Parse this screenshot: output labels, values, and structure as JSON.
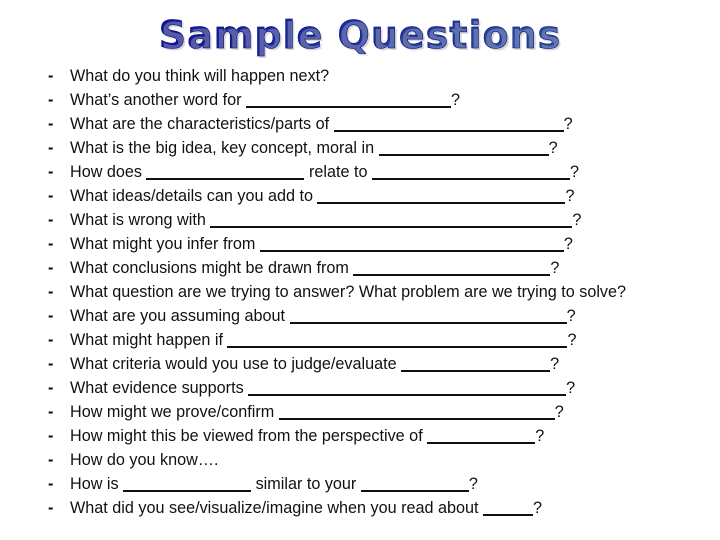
{
  "title": "Sample Questions",
  "bullet": "-",
  "questions": [
    {
      "parts": [
        "What do you think will happen next?"
      ],
      "blanks": []
    },
    {
      "parts": [
        "What’s another word for ",
        "?"
      ],
      "blanks": [
        205
      ]
    },
    {
      "parts": [
        "What are the characteristics/parts of ",
        "?"
      ],
      "blanks": [
        230
      ]
    },
    {
      "parts": [
        "What is the big idea, key concept, moral in ",
        "?"
      ],
      "blanks": [
        170
      ]
    },
    {
      "parts": [
        "How does ",
        " relate to ",
        "?"
      ],
      "blanks": [
        158,
        198
      ]
    },
    {
      "parts": [
        "What ideas/details can you add to ",
        "?"
      ],
      "blanks": [
        248
      ]
    },
    {
      "parts": [
        "What is wrong with ",
        "?"
      ],
      "blanks": [
        362
      ]
    },
    {
      "parts": [
        "What might you infer from ",
        "?"
      ],
      "blanks": [
        304
      ]
    },
    {
      "parts": [
        "What conclusions might be drawn from ",
        "?"
      ],
      "blanks": [
        197
      ]
    },
    {
      "parts": [
        "What question are we trying to answer? What problem are we trying to solve?"
      ],
      "blanks": []
    },
    {
      "parts": [
        "What are you assuming about ",
        "?"
      ],
      "blanks": [
        277
      ]
    },
    {
      "parts": [
        "What might happen if ",
        "?"
      ],
      "blanks": [
        340
      ]
    },
    {
      "parts": [
        "What criteria would you use to judge/evaluate ",
        "?"
      ],
      "blanks": [
        149
      ]
    },
    {
      "parts": [
        "What evidence supports ",
        "?"
      ],
      "blanks": [
        318
      ]
    },
    {
      "parts": [
        "How might we prove/confirm ",
        "?"
      ],
      "blanks": [
        276
      ]
    },
    {
      "parts": [
        "How might this be viewed from the perspective of ",
        "?"
      ],
      "blanks": [
        108
      ]
    },
    {
      "parts": [
        "How do you know…."
      ],
      "blanks": []
    },
    {
      "parts": [
        "How is ",
        " similar to your ",
        "?"
      ],
      "blanks": [
        128,
        108
      ]
    },
    {
      "parts": [
        "What did you see/visualize/imagine when you read about ",
        "?"
      ],
      "blanks": [
        50
      ]
    }
  ],
  "colors": {
    "title_start": "#12129a",
    "title_end": "#2a4fa8",
    "text": "#111111",
    "background": "#ffffff"
  }
}
